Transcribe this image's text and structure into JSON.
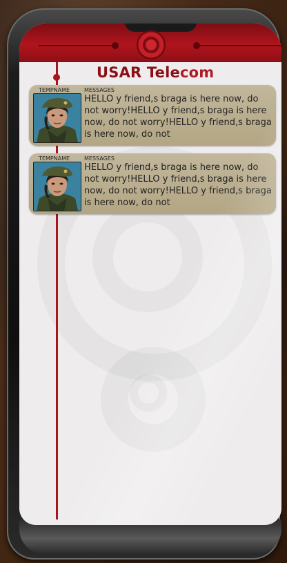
{
  "app": {
    "title_main": "USAR Tele",
    "title_suffix": "com"
  },
  "messages": [
    {
      "sender": "TEMPNAME",
      "label": "MESSAGES",
      "text": "HELLO y friend,s  braga is here now, do not worry!HELLO y friend,s braga is here now, do not worry!HELLO y friend,s braga is here now, do not"
    },
    {
      "sender": "TEMPNAME",
      "label": "MESSAGES",
      "text": "HELLO y friend,s  braga is here now, do not worry!HELLO y friend,s braga is here now, do not worry!HELLO y friend,s braga is here now, do not"
    }
  ],
  "colors": {
    "accent": "#a8161d",
    "card": "#bcb093",
    "screen": "#eeeced"
  },
  "icons": {
    "avatar": "soldier-portrait",
    "emblem": "red-circle-emblem"
  }
}
